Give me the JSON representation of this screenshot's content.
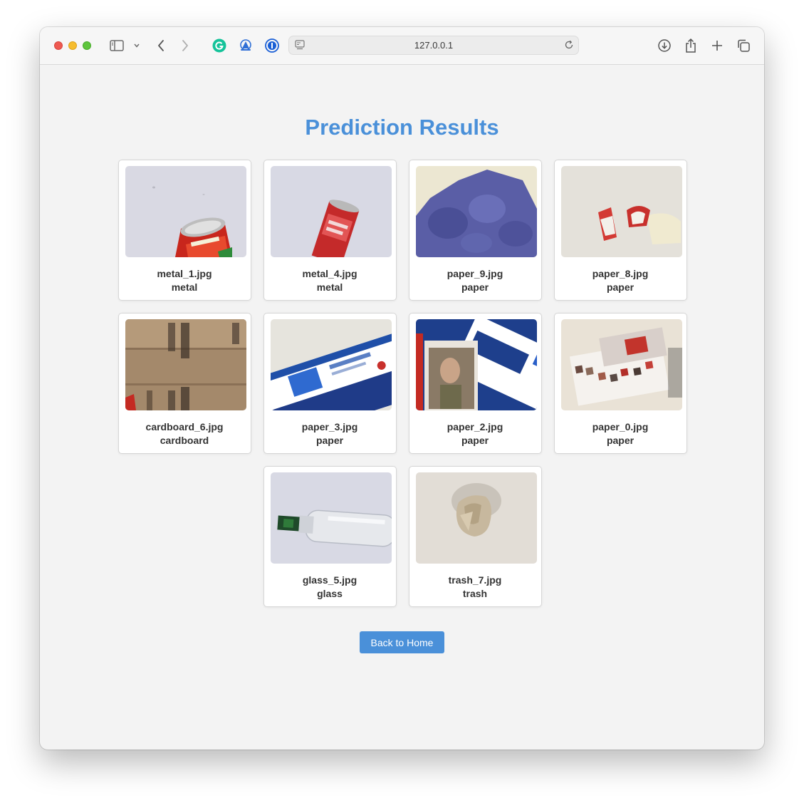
{
  "browser": {
    "url": "127.0.0.1"
  },
  "page": {
    "title": "Prediction Results",
    "back_button": "Back to Home"
  },
  "results": [
    {
      "file": "metal_1.jpg",
      "label": "metal"
    },
    {
      "file": "metal_4.jpg",
      "label": "metal"
    },
    {
      "file": "paper_9.jpg",
      "label": "paper"
    },
    {
      "file": "paper_8.jpg",
      "label": "paper"
    },
    {
      "file": "cardboard_6.jpg",
      "label": "cardboard"
    },
    {
      "file": "paper_3.jpg",
      "label": "paper"
    },
    {
      "file": "paper_2.jpg",
      "label": "paper"
    },
    {
      "file": "paper_0.jpg",
      "label": "paper"
    },
    {
      "file": "glass_5.jpg",
      "label": "glass"
    },
    {
      "file": "trash_7.jpg",
      "label": "trash"
    }
  ],
  "colors": {
    "accent": "#4a90d9",
    "page_background": "#f3f3f3"
  }
}
